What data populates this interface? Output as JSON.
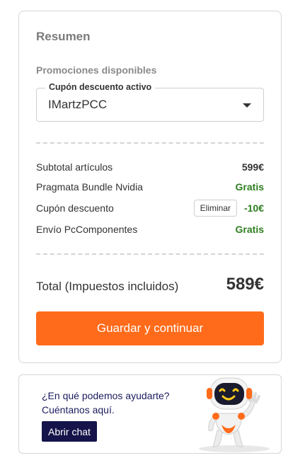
{
  "summary": {
    "title": "Resumen",
    "promotions_title": "Promociones disponibles",
    "coupon_label": "Cupón descuento activo",
    "coupon_value": "IMartzPCC",
    "rows": [
      {
        "label": "Subtotal artículos",
        "value": "599€"
      },
      {
        "label": "Pragmata Bundle Nvidia",
        "value": "Gratis"
      },
      {
        "label": "Cupón descuento",
        "value": "-10€",
        "action": "Eliminar"
      },
      {
        "label": "Envío PcComponentes",
        "value": "Gratis"
      }
    ],
    "total_label": "Total (Impuestos incluidos)",
    "total_value": "589€",
    "save_button": "Guardar y continuar"
  },
  "help": {
    "line1": "¿En qué podemos ayudarte?",
    "line2": "Cuéntanos aquí.",
    "chat_button": "Abrir chat",
    "mascot_icon": "robot-mascot-icon"
  },
  "colors": {
    "accent": "#ff6b1a",
    "free_green": "#2e7d1f",
    "help_navy": "#14144a"
  }
}
